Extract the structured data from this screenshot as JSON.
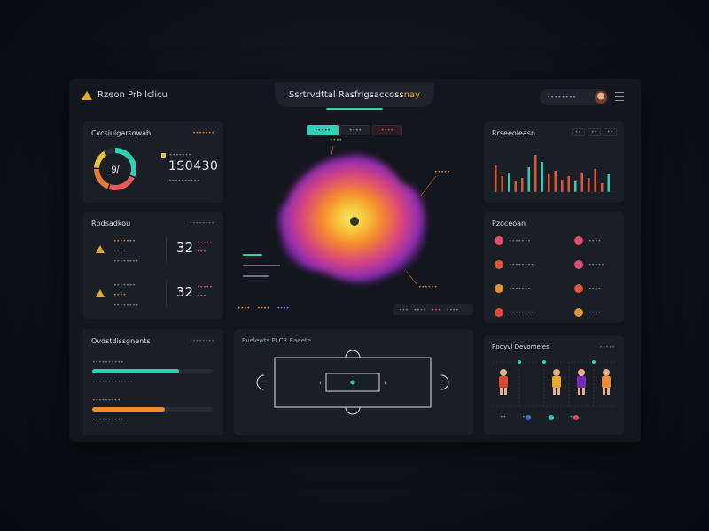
{
  "app": {
    "name": "Rzeon PrÞ lclicu",
    "user": "••••••••"
  },
  "header": {
    "title_main": "Ssrtrvdttal Rasfrigsaccoss",
    "title_accent": "nay"
  },
  "overview": {
    "title": "Cxcsiuigarsowab",
    "sub": "•••••••",
    "donut_center": "9/",
    "legend_label": "•••••••",
    "value": "1S0430",
    "caption": "••••••••••",
    "donut_segments": [
      {
        "color": "#2fd0b6",
        "fraction": 0.32
      },
      {
        "color": "#e65b5b",
        "fraction": 0.24
      },
      {
        "color": "#e57a3a",
        "fraction": 0.2
      },
      {
        "color": "#e8c43a",
        "fraction": 0.16
      },
      {
        "color": "#2a2f38",
        "fraction": 0.08
      }
    ]
  },
  "stats": {
    "title": "Rbdsadkou",
    "sub": "••••••••",
    "rows": [
      {
        "label1": "•••••••",
        "label2": "••••",
        "label3": "••••••••",
        "value": "32",
        "tag1": "•••••",
        "tag2": "•••"
      },
      {
        "label1": "•••••••",
        "label2": "••••",
        "label3": "••••••••",
        "value": "32",
        "tag1": "•••••",
        "tag2": "•••"
      }
    ]
  },
  "progress": {
    "title": "Ovdstdissgnents",
    "sub": "••••••••",
    "items": [
      {
        "label": "••••••••••",
        "caption": "•••••••••••••",
        "fraction": 0.72,
        "color": "#2fd0b6"
      },
      {
        "label": "•••••••••",
        "caption": "••••••••••",
        "fraction": 0.6,
        "color": "#f28a30"
      }
    ]
  },
  "center": {
    "tabs": [
      {
        "label": "•••••",
        "active": true
      },
      {
        "label": "••••",
        "active": false
      },
      {
        "label": "••••",
        "active": false
      }
    ],
    "callout_top": "••••",
    "callout_right": "•••••",
    "callout_bottom": "••••••",
    "legend_left": [
      "•••",
      "•••",
      "•••"
    ],
    "bottom_left": [
      "••••",
      "••••",
      "••••"
    ],
    "bottom_right": [
      "•••",
      "••••",
      "•••",
      "••••"
    ]
  },
  "field": {
    "title": "Evelewts PLCR Eaeete"
  },
  "trend": {
    "title": "Rrseeoleasn",
    "controls": [
      "••",
      "••",
      "••"
    ]
  },
  "players": {
    "title": "Pzoceoan",
    "rows": [
      {
        "left_dot": "#e24b6b",
        "left": "•••••••",
        "right_dot": "#e24b6b",
        "right": "••••"
      },
      {
        "left_dot": "#e0553a",
        "left": "••••••••",
        "right_dot": "#e24b6b",
        "right": "•••••"
      },
      {
        "left_dot": "#e3903a",
        "left": "•••••••",
        "right_dot": "#e0553a",
        "right": "••••"
      },
      {
        "left_dot": "#e24b3a",
        "left": "••••••••",
        "right_dot": "#e3903a",
        "right": "••••"
      }
    ]
  },
  "lineup": {
    "title": "Rooyvl Devomeies",
    "sub": "•••••",
    "chips": [
      "••",
      "•••",
      "••",
      "••"
    ]
  }
}
